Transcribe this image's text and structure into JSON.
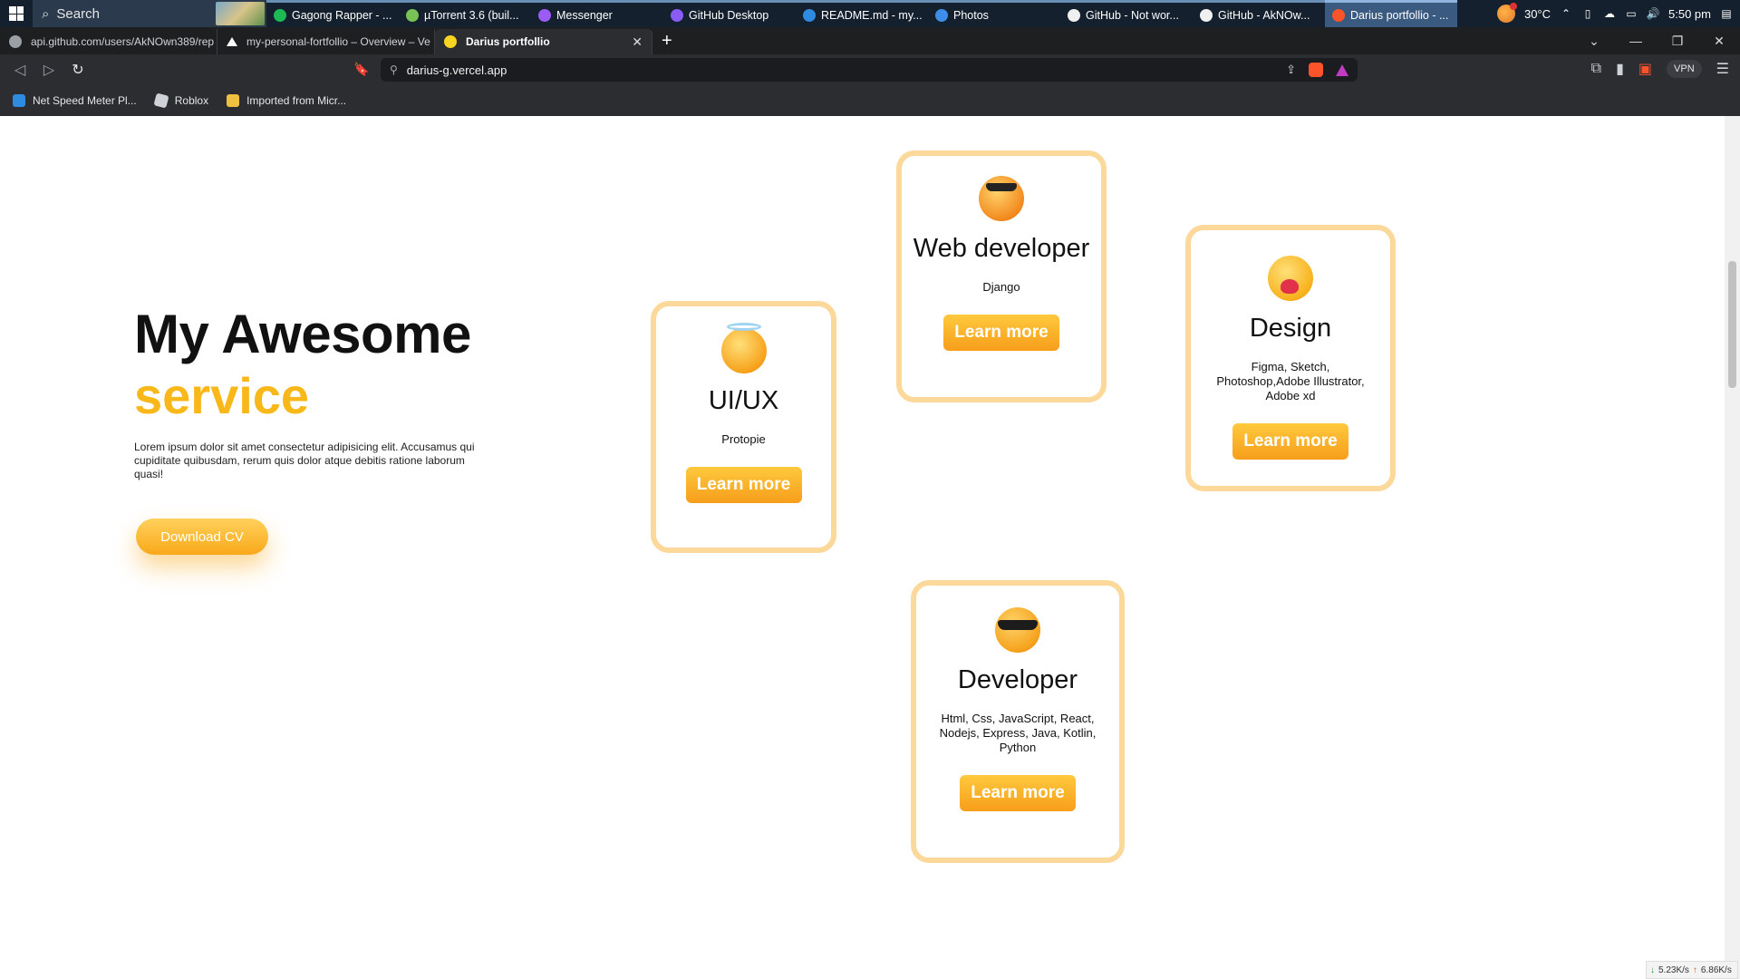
{
  "taskbar": {
    "search_placeholder": "Search",
    "apps": [
      {
        "label": "Gagong Rapper - ...",
        "color": "#1db954"
      },
      {
        "label": "µTorrent 3.6  (buil...",
        "color": "#78c257"
      },
      {
        "label": "Messenger",
        "color": "#9b5cf6"
      },
      {
        "label": "GitHub Desktop",
        "color": "#8a5cf6"
      },
      {
        "label": "README.md - my...",
        "color": "#2f8be0"
      },
      {
        "label": "Photos",
        "color": "#3c8ee8"
      },
      {
        "label": "GitHub - Not wor...",
        "color": "#f0f0f0"
      },
      {
        "label": "GitHub - AkNOw...",
        "color": "#f0f0f0"
      },
      {
        "label": "Darius portfollio - ...",
        "color": "#fb542b"
      }
    ],
    "weather": "30°C",
    "time": "5:50 pm"
  },
  "browser": {
    "tabs": [
      {
        "label": "api.github.com/users/AkNOwn389/rep",
        "color": "#9aa0a6"
      },
      {
        "label": "my-personal-fortfollio – Overview – Ve",
        "color": "#ffffff"
      },
      {
        "label": "Darius portfollio",
        "color": "#f9d423"
      }
    ],
    "url": "darius-g.vercel.app",
    "vpn": "VPN",
    "bookmarks": [
      {
        "label": "Net Speed Meter Pl...",
        "color": "#2f8be0"
      },
      {
        "label": "Roblox",
        "color": "#cfd3d8"
      },
      {
        "label": "Imported from Micr...",
        "color": "#f0c040"
      }
    ]
  },
  "hero": {
    "title": "My Awesome",
    "subtitle": "service",
    "description": "Lorem ipsum dolor sit amet consectetur adipisicing elit. Accusamus qui cupiditate quibusdam, rerum quis dolor atque debitis ratione laborum quasi!",
    "cv_button": "Download CV"
  },
  "services": [
    {
      "title": "UI/UX",
      "tools": "Protopie",
      "button": "Learn more",
      "emoji": "smiling-halo-emoji-icon"
    },
    {
      "title": "Web developer",
      "tools": "Django",
      "button": "Learn more",
      "emoji": "sunglasses-emoji-icon"
    },
    {
      "title": "Design",
      "tools": "Figma, Sketch, Photoshop,Adobe Illustrator, Adobe xd",
      "button": "Learn more",
      "emoji": "hugging-emoji-icon"
    },
    {
      "title": "Developer",
      "tools": "Html, Css, JavaScript, React, Nodejs, Express, Java, Kotlin, Python",
      "button": "Learn more",
      "emoji": "cool-sunglasses-emoji-icon"
    }
  ],
  "netspeed": {
    "down": "5.23K/s",
    "up": "6.86K/s"
  }
}
